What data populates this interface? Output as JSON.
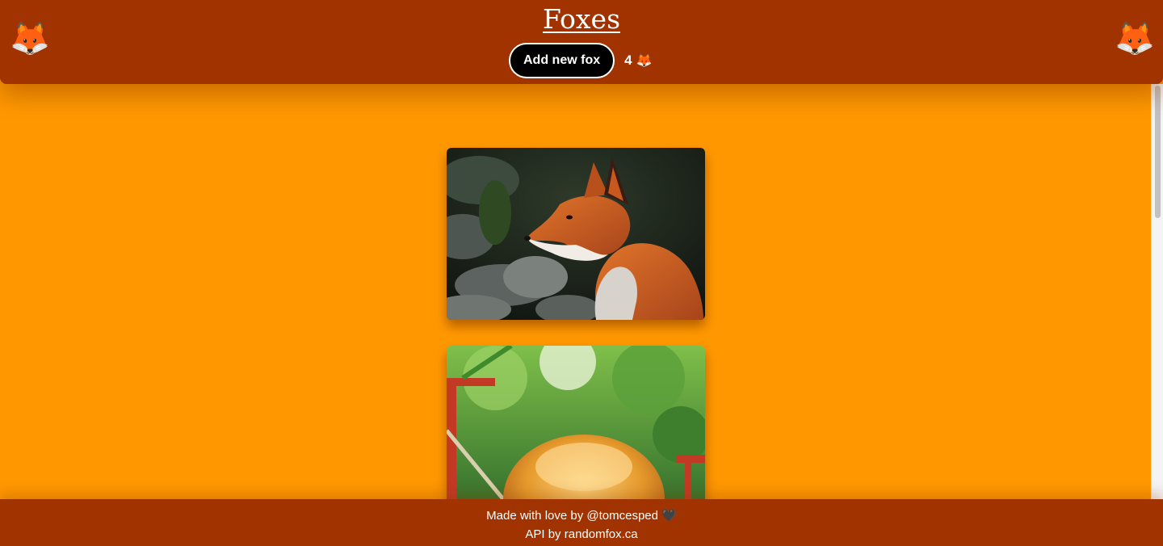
{
  "colors": {
    "page_bg": "#ff9800",
    "header_bg": "#a03300",
    "footer_bg": "#a03300",
    "button_bg": "#000000",
    "text": "#ffffff"
  },
  "header": {
    "title": "Foxes",
    "corner_icon": "🦊",
    "add_button_label": "Add new fox",
    "fox_count": "4",
    "count_icon": "🦊"
  },
  "feed": {
    "items": [
      {
        "alt": "red fox portrait on rocks",
        "icon": "fox-photo"
      },
      {
        "alt": "fluffy fox in forest",
        "icon": "fox-photo"
      }
    ]
  },
  "footer": {
    "made_by": "Made with love by @tomcesped 🖤",
    "api_credit": "API by randomfox.ca"
  }
}
